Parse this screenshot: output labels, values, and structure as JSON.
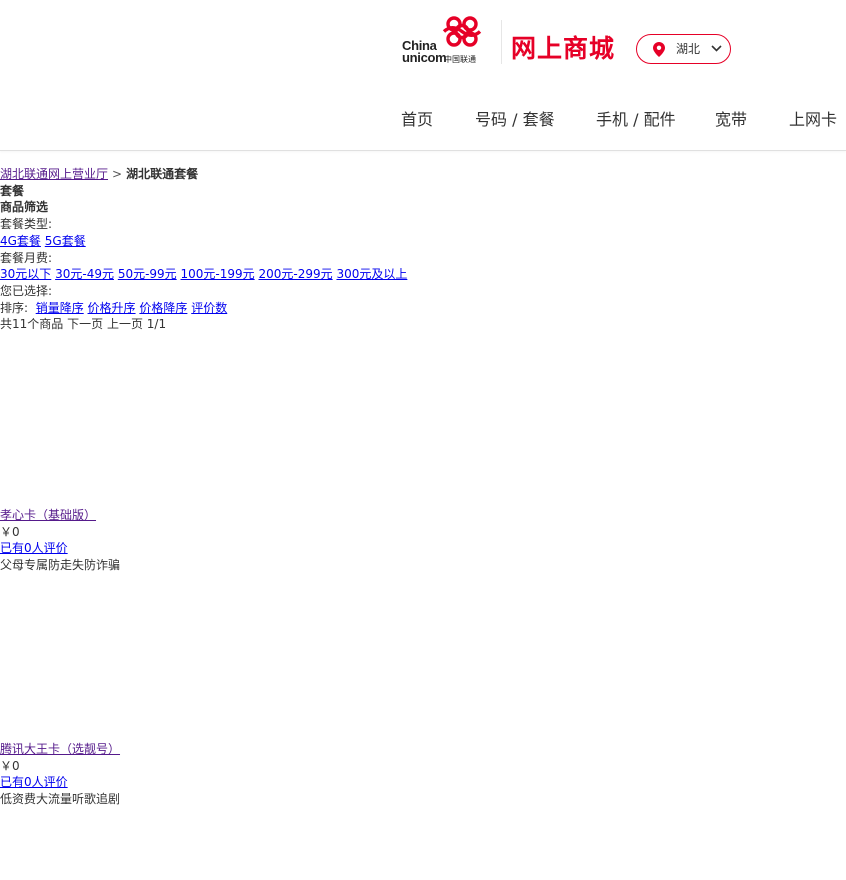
{
  "header": {
    "logo": {
      "text_en_line1": "China",
      "text_en_line2": "unicom",
      "text_cn": "中国联通"
    },
    "mall_title": "网上商城",
    "region": {
      "label": "湖北"
    },
    "nav": [
      {
        "label": "首页"
      },
      {
        "label": "号码 / 套餐"
      },
      {
        "label": "手机 / 配件"
      },
      {
        "label": "宽带"
      },
      {
        "label": "上网卡"
      }
    ]
  },
  "breadcrumb": {
    "home": "湖北联通网上营业厅",
    "separator": ">",
    "current": "湖北联通套餐"
  },
  "section_title": "套餐",
  "filter": {
    "title": "商品筛选",
    "type_label": "套餐类型:",
    "type_options": [
      "4G套餐",
      "5G套餐"
    ],
    "fee_label": "套餐月费:",
    "fee_options": [
      "30元以下",
      "30元-49元",
      "50元-99元",
      "100元-199元",
      "200元-299元",
      "300元及以上"
    ],
    "selected_label": "您已选择:"
  },
  "sort": {
    "label": "排序:",
    "options": [
      "销量降序",
      "价格升序",
      "价格降序",
      "评价数"
    ]
  },
  "pagination": {
    "total": "共11个商品",
    "next": "下一页",
    "prev": "上一页",
    "page": "1/1"
  },
  "products": [
    {
      "name": "孝心卡（基础版）",
      "price": "￥0",
      "reviews": "已有0人评价",
      "desc": "父母专属防走失防诈骗"
    },
    {
      "name": "腾讯大王卡（选靓号）",
      "price": "￥0",
      "reviews": "已有0人评价",
      "desc": "低资费大流量听歌追剧"
    }
  ],
  "colors": {
    "brand_red": "#e60027",
    "link": "#0000ee",
    "link_visited": "#551a8b"
  }
}
